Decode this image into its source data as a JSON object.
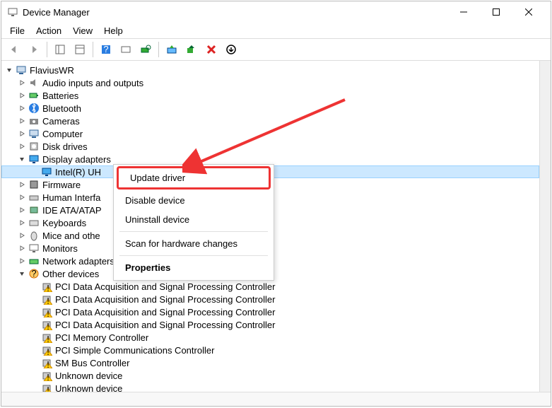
{
  "title": "Device Manager",
  "menus": {
    "file": "File",
    "action": "Action",
    "view": "View",
    "help": "Help"
  },
  "root_node": "FlaviusWR",
  "categories": [
    {
      "name": "Audio inputs and outputs",
      "expanded": false,
      "icon": "audio"
    },
    {
      "name": "Batteries",
      "expanded": false,
      "icon": "battery"
    },
    {
      "name": "Bluetooth",
      "expanded": false,
      "icon": "bluetooth"
    },
    {
      "name": "Cameras",
      "expanded": false,
      "icon": "camera"
    },
    {
      "name": "Computer",
      "expanded": false,
      "icon": "computer"
    },
    {
      "name": "Disk drives",
      "expanded": false,
      "icon": "disk"
    },
    {
      "name": "Display adapters",
      "expanded": true,
      "icon": "display",
      "children": [
        {
          "name": "Intel(R) UH",
          "icon": "display",
          "selected": true
        }
      ]
    },
    {
      "name": "Firmware",
      "expanded": false,
      "icon": "firmware"
    },
    {
      "name": "Human Interfa",
      "expanded": false,
      "icon": "hid"
    },
    {
      "name": "IDE ATA/ATAP",
      "expanded": false,
      "icon": "ide"
    },
    {
      "name": "Keyboards",
      "expanded": false,
      "icon": "keyboard"
    },
    {
      "name": "Mice and othe",
      "expanded": false,
      "icon": "mouse"
    },
    {
      "name": "Monitors",
      "expanded": false,
      "icon": "monitor"
    },
    {
      "name": "Network adapters",
      "expanded": false,
      "icon": "network"
    },
    {
      "name": "Other devices",
      "expanded": true,
      "icon": "other",
      "children": [
        {
          "name": "PCI Data Acquisition and Signal Processing Controller",
          "icon": "warn"
        },
        {
          "name": "PCI Data Acquisition and Signal Processing Controller",
          "icon": "warn"
        },
        {
          "name": "PCI Data Acquisition and Signal Processing Controller",
          "icon": "warn"
        },
        {
          "name": "PCI Data Acquisition and Signal Processing Controller",
          "icon": "warn"
        },
        {
          "name": "PCI Memory Controller",
          "icon": "warn"
        },
        {
          "name": "PCI Simple Communications Controller",
          "icon": "warn"
        },
        {
          "name": "SM Bus Controller",
          "icon": "warn"
        },
        {
          "name": "Unknown device",
          "icon": "warn"
        },
        {
          "name": "Unknown device",
          "icon": "warn"
        }
      ]
    }
  ],
  "context_menu": {
    "update": "Update driver",
    "disable": "Disable device",
    "uninstall": "Uninstall device",
    "scan": "Scan for hardware changes",
    "properties": "Properties"
  }
}
